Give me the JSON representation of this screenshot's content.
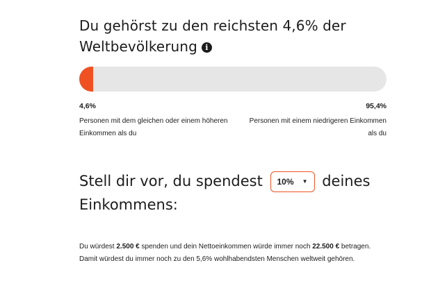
{
  "header": {
    "headline": "Du gehörst zu den reichsten 4,6% der Weltbevölkerung",
    "info_icon_glyph": "i"
  },
  "progress": {
    "richer_fraction": 0.046,
    "fill_color": "#f05123",
    "track_color": "#e6e6e6"
  },
  "legend": {
    "left_percent": "4,6%",
    "left_description": "Personen mit dem gleichen oder einem höheren Einkommen als du",
    "right_percent": "95,4%",
    "right_description": "Personen mit einem niedrigeren Einkommen als du"
  },
  "pledge": {
    "text_before": "Stell dir vor, du spendest",
    "select_value": "10%",
    "caret_icon": "caret-down-icon",
    "text_after": "deines Einkommens:"
  },
  "summary": {
    "part1": "Du würdest ",
    "donation_amount": "2.500 €",
    "part2": " spenden und dein Nettoeinkommen würde immer noch ",
    "net_income": "22.500 €",
    "part3": " betragen. Damit würdest du immer noch zu den 5,6% wohlhabendsten Menschen weltweit gehören."
  },
  "accent_color": "#f05123"
}
